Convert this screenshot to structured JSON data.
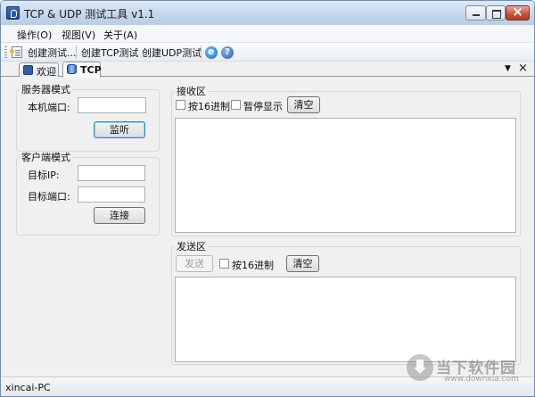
{
  "window": {
    "title": "TCP & UDP 测试工具 v1.1"
  },
  "menu": [
    "操作(O)",
    "视图(V)",
    "关于(A)"
  ],
  "toolbar": {
    "create_test": "创建测试...",
    "create_tcp": "创建TCP测试",
    "create_udp": "创建UDP测试"
  },
  "tabs": [
    {
      "label": "欢迎",
      "active": false
    },
    {
      "label": "TCP",
      "active": true
    }
  ],
  "server": {
    "legend": "服务器模式",
    "port_label": "本机端口:",
    "port_value": "",
    "listen_button": "监听"
  },
  "client": {
    "legend": "客户端模式",
    "ip_label": "目标IP:",
    "ip_value": "",
    "port_label": "目标端口:",
    "port_value": "",
    "connect_button": "连接"
  },
  "receive": {
    "legend": "接收区",
    "hex_label": "按16进制",
    "hex_checked": false,
    "pause_label": "暂停显示",
    "pause_checked": false,
    "clear_button": "清空",
    "content": ""
  },
  "send": {
    "legend": "发送区",
    "send_button": "发送",
    "hex_label": "按16进制",
    "hex_checked": false,
    "clear_button": "清空",
    "content": ""
  },
  "status": {
    "text": "xincai-PC"
  },
  "watermark": {
    "name": "当下软件园",
    "url": "www.downxia.com"
  },
  "colors": {
    "titlebar": "#c6d7ec",
    "close_button": "#c8513f",
    "focus_border": "#3c7fb1"
  }
}
